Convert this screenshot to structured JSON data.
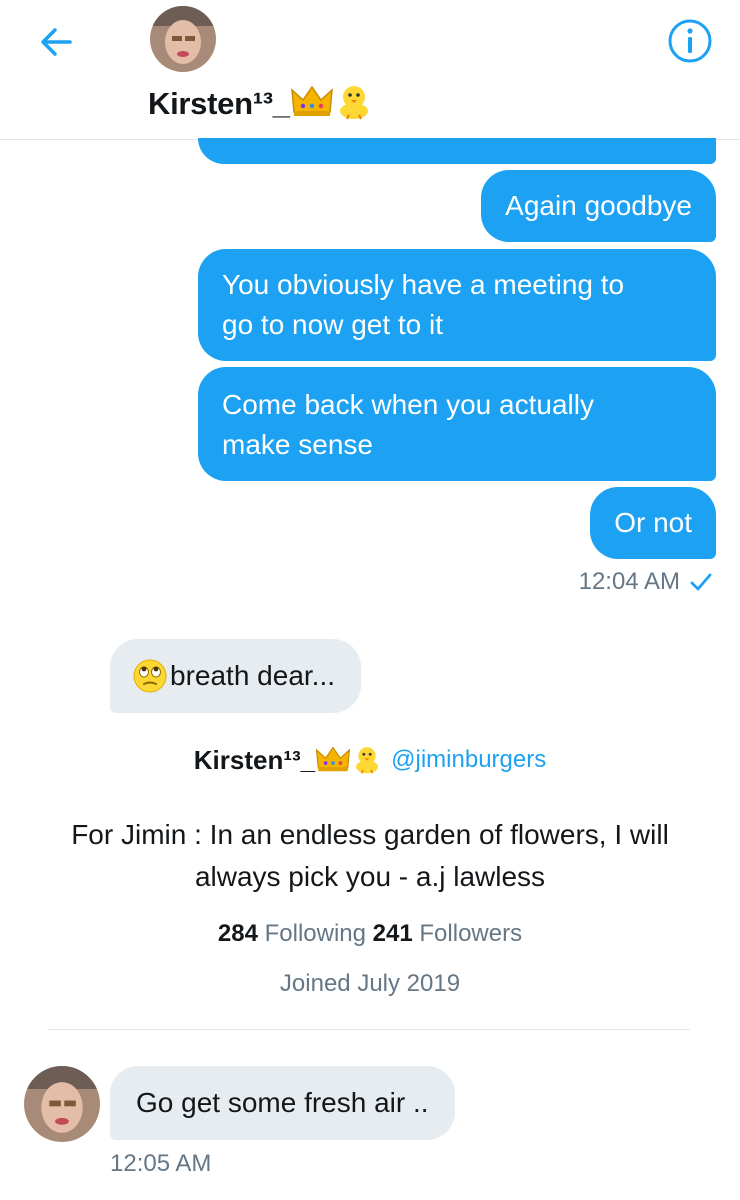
{
  "header": {
    "name": "Kirsten¹³_",
    "back_icon": "arrow-left-icon",
    "info_icon": "info-circle-icon",
    "accent": "#1da1f2"
  },
  "messages_out": [
    {
      "text": ""
    },
    {
      "text": "Again goodbye"
    },
    {
      "line1": "You obviously have a meeting to",
      "line2": "go to now get to it"
    },
    {
      "line1": "Come back when you actually",
      "line2": "make sense"
    },
    {
      "text": "Or not"
    }
  ],
  "status_out": {
    "time": "12:04 AM",
    "icon": "checkmark-icon"
  },
  "message_in_1": {
    "text": "breath dear..."
  },
  "profile_card": {
    "name": "Kirsten¹³_",
    "handle": "@jiminburgers",
    "bio_line1": "For Jimin : In an endless garden of flowers, I will",
    "bio_line2": "always pick you - a.j lawless",
    "following_count": "284",
    "following_label": "Following",
    "followers_count": "241",
    "followers_label": "Followers",
    "joined": "Joined July 2019"
  },
  "message_in_2": {
    "text": "Go get some fresh air .."
  },
  "status_in": {
    "time": "12:05 AM"
  }
}
